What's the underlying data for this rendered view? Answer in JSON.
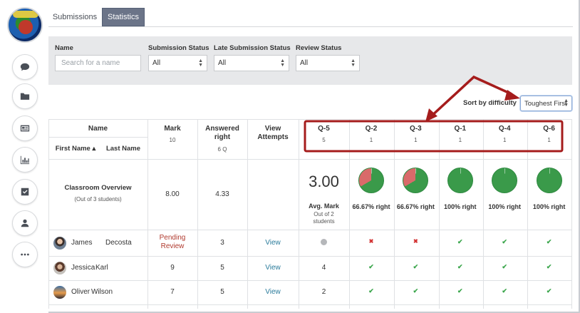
{
  "tabs": {
    "submissions": "Submissions",
    "statistics": "Statistics"
  },
  "filters": {
    "name_label": "Name",
    "name_placeholder": "Search for a name",
    "submission_status_label": "Submission Status",
    "submission_status_value": "All",
    "late_status_label": "Late Submission Status",
    "late_status_value": "All",
    "review_status_label": "Review Status",
    "review_status_value": "All"
  },
  "sort": {
    "label": "Sort by difficulty",
    "value": "Toughest First"
  },
  "table": {
    "name_header": "Name",
    "first_name_header": "First Name ▴",
    "last_name_header": "Last Name",
    "mark_header": "Mark",
    "mark_sub": "10",
    "answered_header": "Answered right",
    "answered_sub": "6 Q",
    "view_header": "View Attempts",
    "questions": [
      {
        "label": "Q-5",
        "sub": "5"
      },
      {
        "label": "Q-2",
        "sub": "1"
      },
      {
        "label": "Q-3",
        "sub": "1"
      },
      {
        "label": "Q-1",
        "sub": "1"
      },
      {
        "label": "Q-4",
        "sub": "1"
      },
      {
        "label": "Q-6",
        "sub": "1"
      }
    ],
    "overview": {
      "title": "Classroom Overview",
      "subtitle": "(Out of 3 students)",
      "mark": "8.00",
      "answered": "4.33",
      "avg_value": "3.00",
      "avg_label": "Avg. Mark",
      "avg_sub": "Out of 2 students",
      "question_stats": [
        {
          "text": "66.67% right",
          "right_fraction": 0.6667
        },
        {
          "text": "66.67% right",
          "right_fraction": 0.6667
        },
        {
          "text": "100% right",
          "right_fraction": 1.0
        },
        {
          "text": "100% right",
          "right_fraction": 1.0
        },
        {
          "text": "100% right",
          "right_fraction": 1.0
        }
      ]
    },
    "students": [
      {
        "first": "James",
        "last": "Decosta",
        "mark": "Pending Review",
        "answered": "3",
        "view": "View",
        "q5": "dot",
        "results": [
          "cross",
          "cross",
          "check",
          "check",
          "check"
        ]
      },
      {
        "first": "Jessica",
        "last": "Karl",
        "mark": "9",
        "answered": "5",
        "view": "View",
        "q5": "4",
        "results": [
          "check",
          "check",
          "check",
          "check",
          "check"
        ]
      },
      {
        "first": "Oliver",
        "last": "Wilson",
        "mark": "7",
        "answered": "5",
        "view": "View",
        "q5": "2",
        "results": [
          "check",
          "check",
          "check",
          "check",
          "check"
        ]
      }
    ]
  },
  "colors": {
    "accent_tab": "#6b7488",
    "pie_right": "#3a9a4a",
    "pie_wrong": "#d96a6a",
    "annotation": "#a51c1c"
  },
  "icons": [
    "chat-icon",
    "folder-icon",
    "newspaper-icon",
    "bar-chart-icon",
    "checkbox-icon",
    "user-icon",
    "more-icon"
  ]
}
